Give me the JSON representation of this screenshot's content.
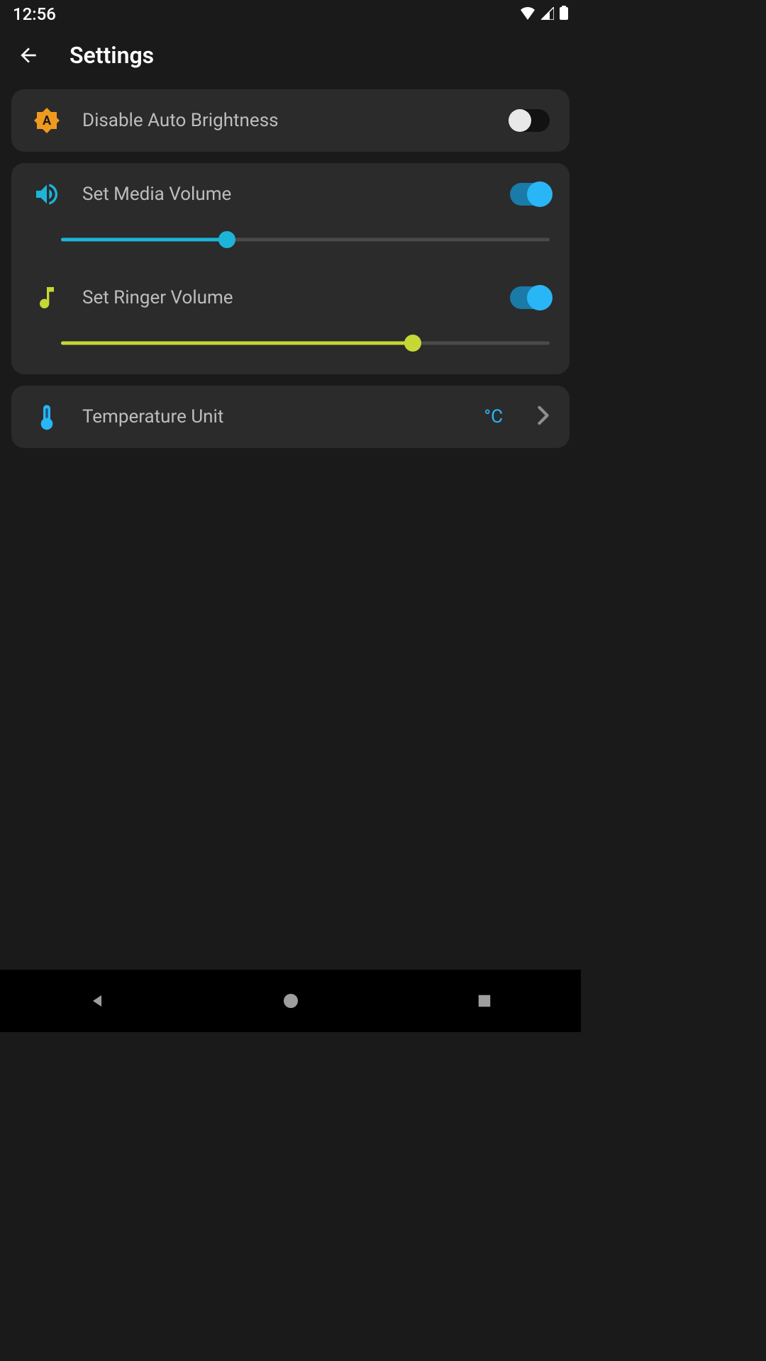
{
  "status": {
    "time": "12:56"
  },
  "header": {
    "title": "Settings"
  },
  "brightness": {
    "label": "Disable Auto Brightness",
    "toggle": false
  },
  "media_volume": {
    "label": "Set Media Volume",
    "toggle": true,
    "value": 34
  },
  "ringer_volume": {
    "label": "Set Ringer Volume",
    "toggle": true,
    "value": 72
  },
  "temperature": {
    "label": "Temperature Unit",
    "value": "°C"
  }
}
